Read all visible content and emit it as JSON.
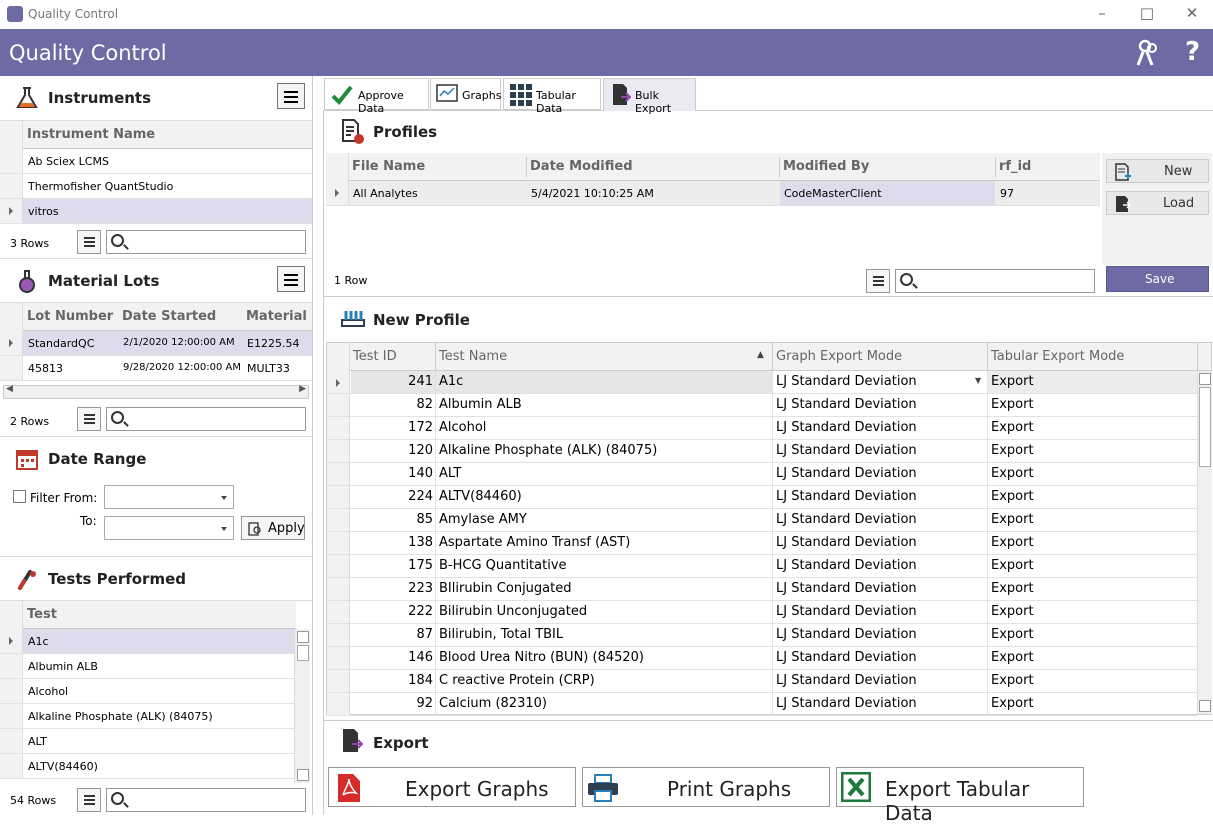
{
  "window": {
    "title": "Quality Control"
  },
  "header": {
    "title": "Quality Control"
  },
  "instruments": {
    "title": "Instruments",
    "column": "Instrument Name",
    "rows": [
      "Ab Sciex LCMS",
      "Thermofisher QuantStudio",
      "vitros"
    ],
    "count": "3 Rows"
  },
  "material_lots": {
    "title": "Material Lots",
    "columns": [
      "Lot Number",
      "Date Started",
      "Material"
    ],
    "rows": [
      [
        "StandardQC",
        "2/1/2020 12:00:00 AM",
        "E1225.54"
      ],
      [
        "45813",
        "9/28/2020 12:00:00 AM",
        "MULT33"
      ]
    ],
    "count": "2 Rows"
  },
  "date_range": {
    "title": "Date Range",
    "filter_from": "Filter From:",
    "to": "To:",
    "apply": "Apply"
  },
  "tests_performed": {
    "title": "Tests Performed",
    "column": "Test",
    "rows": [
      "A1c",
      "Albumin ALB",
      "Alcohol",
      "Alkaline Phosphate (ALK) (84075)",
      "ALT",
      "ALTV(84460)"
    ],
    "count": "54 Rows"
  },
  "tabs": [
    "Approve Data",
    "Graphs",
    "Tabular Data",
    "Bulk Export"
  ],
  "profiles": {
    "title": "Profiles",
    "columns": [
      "File Name",
      "Date Modified",
      "Modified By",
      "rf_id"
    ],
    "row": [
      "All Analytes",
      "5/4/2021 10:10:25 AM",
      "CodeMasterClient",
      "97"
    ],
    "count": "1 Row",
    "new": "New",
    "load": "Load",
    "save": "Save"
  },
  "new_profile": {
    "title": "New Profile",
    "columns": [
      "Test ID",
      "Test Name",
      "Graph Export Mode",
      "Tabular Export Mode"
    ],
    "rows": [
      [
        "241",
        "A1c",
        "LJ Standard Deviation",
        "Export"
      ],
      [
        "82",
        "Albumin ALB",
        "LJ Standard Deviation",
        "Export"
      ],
      [
        "172",
        "Alcohol",
        "LJ Standard Deviation",
        "Export"
      ],
      [
        "120",
        "Alkaline Phosphate (ALK) (84075)",
        "LJ Standard Deviation",
        "Export"
      ],
      [
        "140",
        "ALT",
        "LJ Standard Deviation",
        "Export"
      ],
      [
        "224",
        "ALTV(84460)",
        "LJ Standard Deviation",
        "Export"
      ],
      [
        "85",
        "Amylase AMY",
        "LJ Standard Deviation",
        "Export"
      ],
      [
        "138",
        "Aspartate Amino Transf (AST)",
        "LJ Standard Deviation",
        "Export"
      ],
      [
        "175",
        "B-HCG Quantitative",
        "LJ Standard Deviation",
        "Export"
      ],
      [
        "223",
        "BIlirubin Conjugated",
        "LJ Standard Deviation",
        "Export"
      ],
      [
        "222",
        "Bilirubin Unconjugated",
        "LJ Standard Deviation",
        "Export"
      ],
      [
        "87",
        "Bilirubin, Total TBIL",
        "LJ Standard Deviation",
        "Export"
      ],
      [
        "146",
        "Blood Urea Nitro (BUN) (84520)",
        "LJ Standard Deviation",
        "Export"
      ],
      [
        "184",
        "C reactive Protein (CRP)",
        "LJ Standard Deviation",
        "Export"
      ],
      [
        "92",
        "Calcium (82310)",
        "LJ Standard Deviation",
        "Export"
      ]
    ]
  },
  "export": {
    "title": "Export",
    "export_graphs": "Export Graphs",
    "print_graphs": "Print Graphs",
    "export_tabular": "Export Tabular Data"
  },
  "colors": {
    "header_bg": "#6e6aa3",
    "selected_row": "#dcdcec",
    "save_btn": "#6e6aa3"
  }
}
